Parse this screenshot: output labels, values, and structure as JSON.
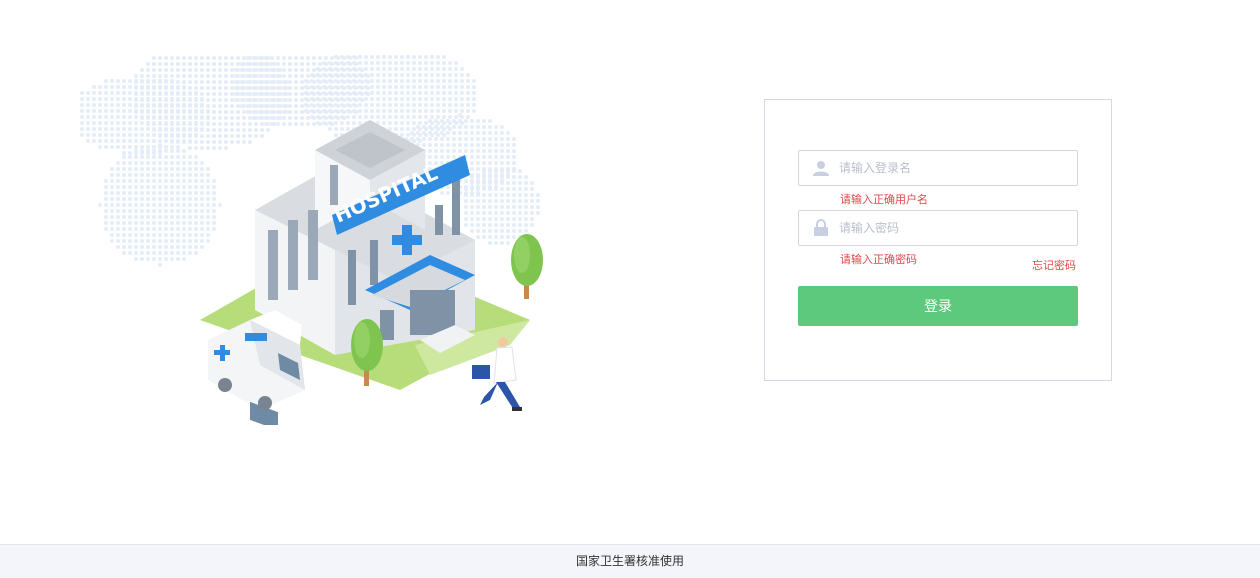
{
  "login": {
    "username_placeholder": "请输入登录名",
    "username_error": "请输入正确用户名",
    "password_placeholder": "请输入密码",
    "password_error": "请输入正确密码",
    "forgot_label": "忘记密码",
    "submit_label": "登录"
  },
  "illustration": {
    "sign_text": "HOSPITAL"
  },
  "footer": {
    "text": "国家卫生署核准使用"
  },
  "colors": {
    "accent_green": "#5dc97c",
    "error_red": "#e0484a",
    "building_blue": "#2f8ce0"
  },
  "icons": {
    "username": "user-icon",
    "password": "lock-icon"
  }
}
